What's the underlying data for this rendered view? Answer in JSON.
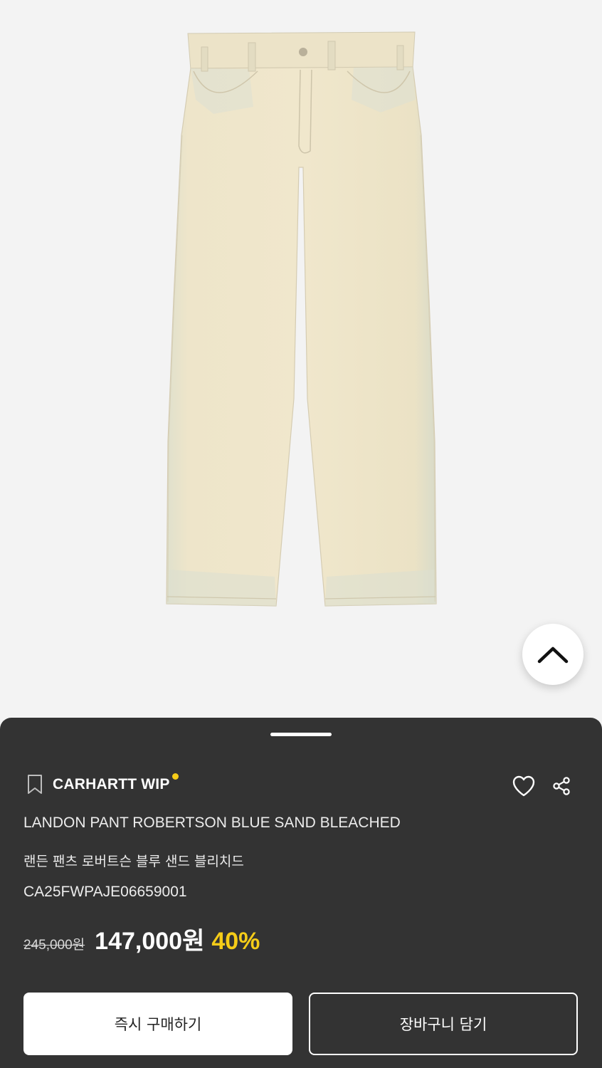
{
  "product": {
    "brand": "CARHARTT WIP",
    "name_en": "LANDON PANT ROBERTSON BLUE SAND BLEACHED",
    "name_ko": "랜든 팬츠 로버트슨 블루 샌드 블리치드",
    "sku": "CA25FWPAJE06659001",
    "original_price": "245,000원",
    "sale_price": "147,000원",
    "discount": "40%"
  },
  "actions": {
    "buy_now": "즉시 구매하기",
    "add_to_cart": "장바구니 담기"
  },
  "icons": {
    "bookmark": "bookmark-icon",
    "wishlist": "heart-icon",
    "share": "share-icon",
    "scroll_top": "chevron-up-icon"
  },
  "colors": {
    "sheet_background": "#333333",
    "accent_yellow": "#f5cc18",
    "page_background": "#f3f3f3",
    "denim": "#ede2c6"
  }
}
